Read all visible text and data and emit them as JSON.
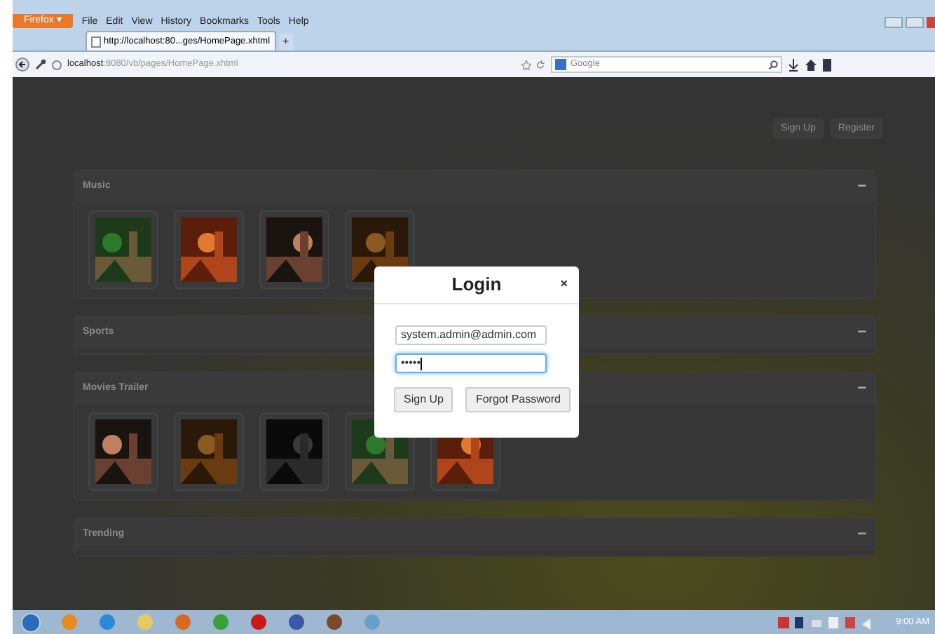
{
  "browser": {
    "app_button": "Firefox",
    "app_caret": "▾",
    "menu": [
      "File",
      "Edit",
      "View",
      "History",
      "Bookmarks",
      "Tools",
      "Help"
    ],
    "tabs": [
      {
        "label": "http://localhost:80...ges/HomePage.xhtml",
        "selected": true
      }
    ],
    "new_tab": "+",
    "address": {
      "host": "localhost",
      "rest": ":8080/vb/pages/HomePage.xhtml"
    },
    "search": {
      "placeholder": "Google"
    }
  },
  "header_buttons": [
    "Sign Up",
    "Register"
  ],
  "sections": [
    {
      "title": "Music",
      "collapse": "−"
    },
    {
      "title": "Sports",
      "collapse": "−"
    },
    {
      "title": "Movies Trailer",
      "collapse": "−"
    },
    {
      "title": "Trending",
      "collapse": "−"
    }
  ],
  "modal": {
    "title": "Login",
    "close": "×",
    "email": {
      "value": "system.admin@admin.com",
      "focused": false
    },
    "password": {
      "value": "•••••",
      "focused": true
    },
    "buttons": [
      "Sign Up",
      "Forgot Password"
    ]
  },
  "taskbar": {
    "clock": "9:00 AM"
  }
}
